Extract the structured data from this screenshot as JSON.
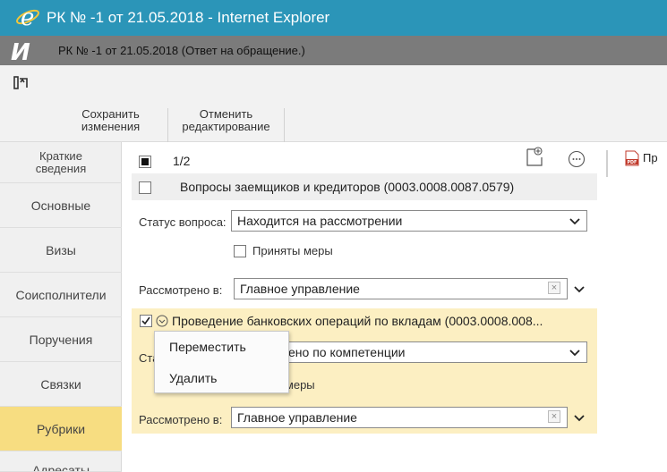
{
  "window": {
    "title": "РК № -1 от 21.05.2018 - Internet Explorer"
  },
  "header": {
    "logo_letter": "И",
    "subtitle": "РК № -1 от 21.05.2018 (Ответ на обращение.)"
  },
  "toolbar": {
    "save_label": "Сохранить\nизменения",
    "cancel_label": "Отменить\nредактирование"
  },
  "sidebar": {
    "items": [
      {
        "label": "Краткие\nсведения",
        "active": false
      },
      {
        "label": "Основные",
        "active": false
      },
      {
        "label": "Визы",
        "active": false
      },
      {
        "label": "Соисполнители",
        "active": false
      },
      {
        "label": "Поручения",
        "active": false
      },
      {
        "label": "Связки",
        "active": false
      },
      {
        "label": "Рубрики",
        "active": true
      },
      {
        "label": "Адресаты",
        "active": false
      }
    ]
  },
  "main": {
    "counter": "1/2",
    "rubric1": {
      "title": "Вопросы заемщиков и кредиторов (0003.0008.0087.0579)",
      "status_label": "Статус вопроса:",
      "status_value": "Находится на рассмотрении",
      "measures_label": "Приняты меры",
      "reviewed_label": "Рассмотрено в:",
      "reviewed_value": "Главное управление"
    },
    "rubric2": {
      "title": "Проведение банковских операций по вкладам (0003.0008.008...",
      "status_label_partial": "Ста",
      "status_value_partial": "ено по компетенции",
      "measures_label_partial": "ты меры",
      "reviewed_label": "Рассмотрено в:",
      "reviewed_value": "Главное управление"
    }
  },
  "context_menu": {
    "items": [
      "Переместить",
      "Удалить"
    ]
  },
  "right_panel": {
    "pdf_label": "Пр"
  },
  "colors": {
    "titlebar": "#2b95b8",
    "highlight": "#fcefc2",
    "active_nav": "#f7dd81"
  }
}
